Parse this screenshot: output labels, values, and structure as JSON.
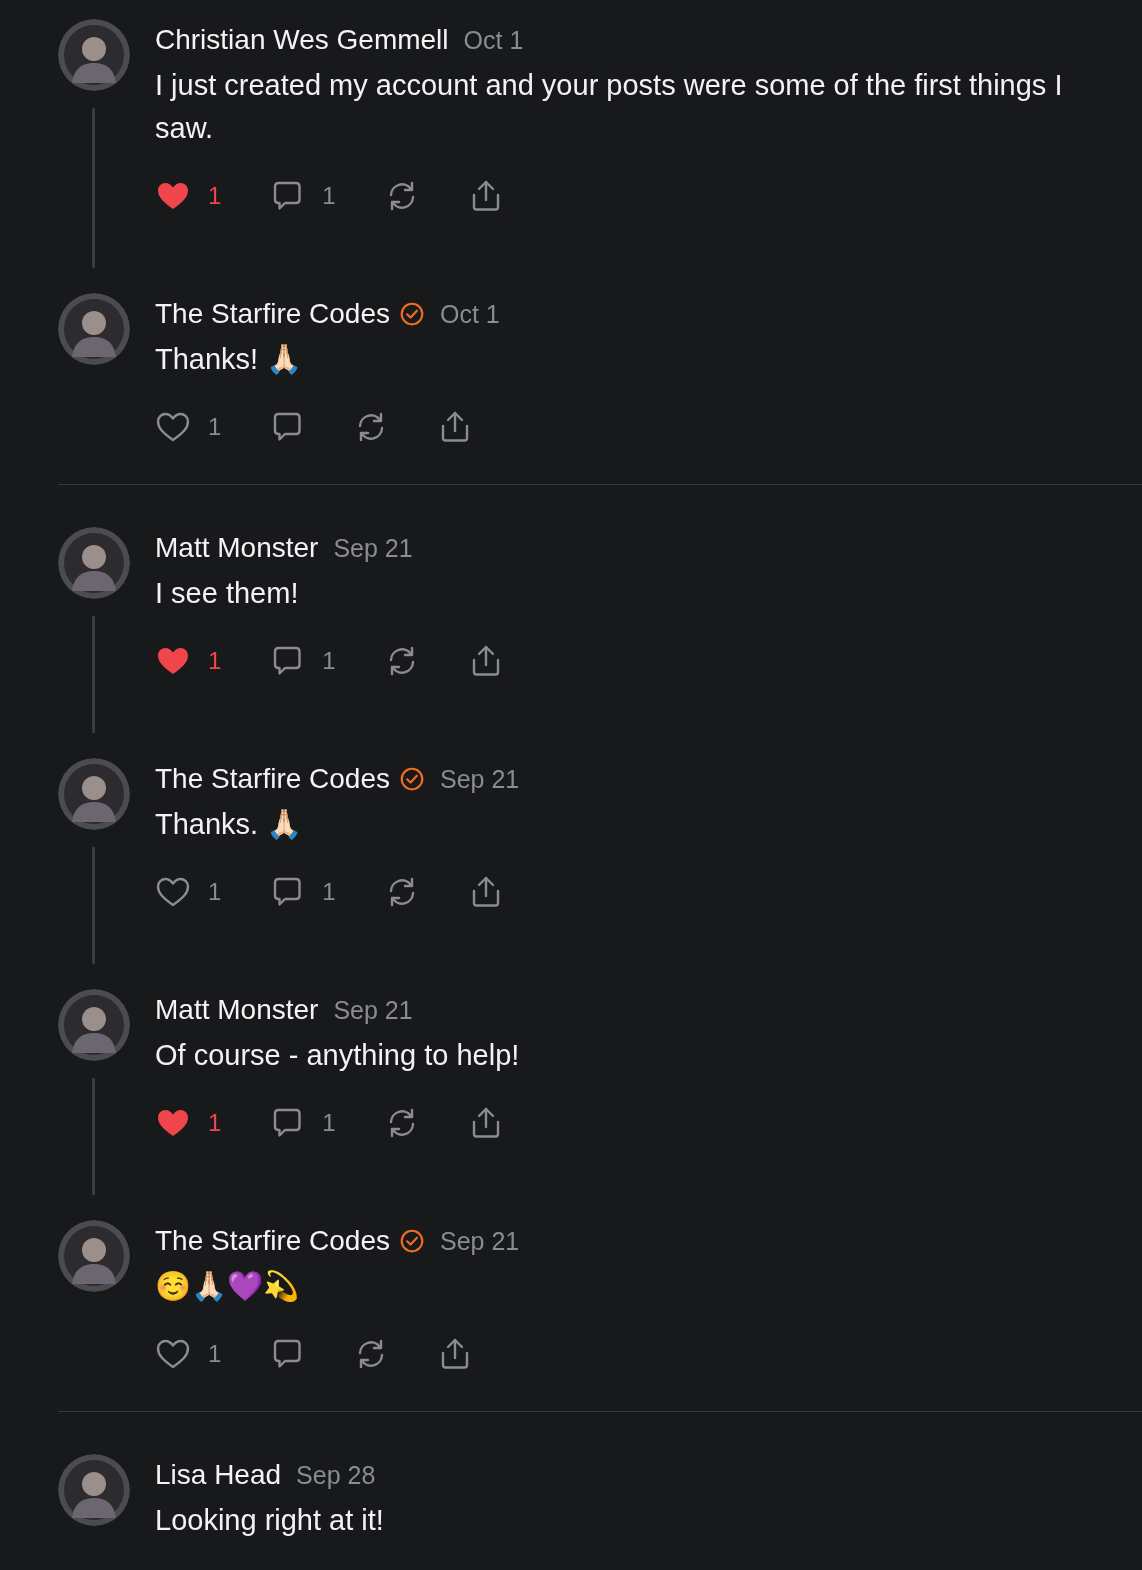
{
  "threads": [
    {
      "posts": [
        {
          "author": "Christian Wes Gemmell",
          "verified": false,
          "date": "Oct 1",
          "text": "I just created my account and your posts were some of the first things I saw.",
          "liked": true,
          "likes": "1",
          "replies": "1"
        },
        {
          "author": "The Starfire Codes",
          "verified": true,
          "date": "Oct 1",
          "text": "Thanks! 🙏🏻",
          "liked": false,
          "likes": "1"
        }
      ]
    },
    {
      "posts": [
        {
          "author": "Matt Monster",
          "verified": false,
          "date": "Sep 21",
          "text": "I see them!",
          "liked": true,
          "likes": "1",
          "replies": "1"
        },
        {
          "author": "The Starfire Codes",
          "verified": true,
          "date": "Sep 21",
          "text": "Thanks. 🙏🏻",
          "liked": false,
          "likes": "1",
          "replies": "1"
        },
        {
          "author": "Matt Monster",
          "verified": false,
          "date": "Sep 21",
          "text": "Of course - anything to help!",
          "liked": true,
          "likes": "1",
          "replies": "1"
        },
        {
          "author": "The Starfire Codes",
          "verified": true,
          "date": "Sep 21",
          "text": "☺️🙏🏻💜💫",
          "liked": false,
          "likes": "1"
        }
      ]
    },
    {
      "posts": [
        {
          "author": "Lisa Head",
          "verified": false,
          "date": "Sep 28",
          "text": "Looking right at it!"
        }
      ]
    }
  ]
}
